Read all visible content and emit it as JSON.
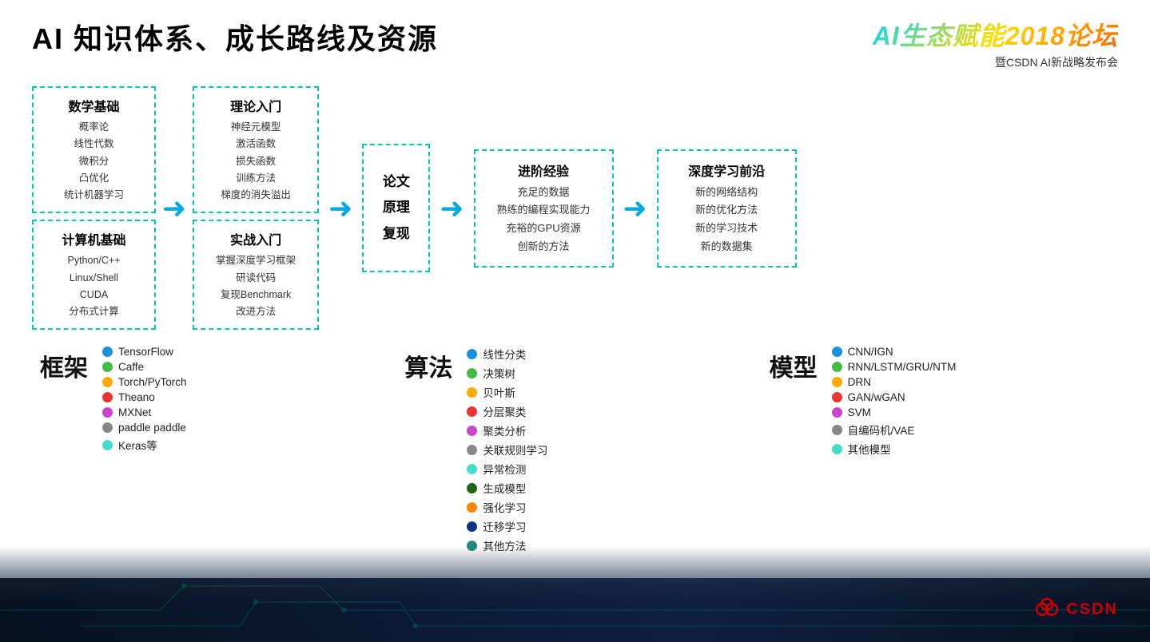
{
  "header": {
    "title": "AI 知识体系、成长路线及资源",
    "logo_main": "AI生态赋能2018论坛",
    "logo_sub": "暨CSDN AI新战略发布会"
  },
  "flow": {
    "left_col": {
      "box1": {
        "title": "数学基础",
        "items": [
          "概率论",
          "线性代数",
          "微积分",
          "凸优化",
          "统计机器学习"
        ]
      },
      "box2": {
        "title": "计算机基础",
        "items": [
          "Python/C++",
          "Linux/Shell",
          "CUDA",
          "分布式计算"
        ]
      }
    },
    "theory_col": {
      "box1": {
        "title": "理论入门",
        "items": [
          "神经元模型",
          "激活函数",
          "损失函数",
          "训练方法",
          "梯度的消失溢出"
        ]
      },
      "box2": {
        "title": "实战入门",
        "items": [
          "掌握深度学习框架",
          "研读代码",
          "复现Benchmark",
          "改进方法"
        ]
      }
    },
    "paper_box": {
      "lines": [
        "论文",
        "原理",
        "复现"
      ]
    },
    "advanced_box": {
      "title": "进阶经验",
      "items": [
        "充足的数据",
        "熟练的编程实现能力",
        "充裕的GPU资源",
        "创新的方法"
      ]
    },
    "deep_box": {
      "title": "深度学习前沿",
      "items": [
        "新的网络结构",
        "新的优化方法",
        "新的学习技术",
        "新的数据集"
      ]
    }
  },
  "legends": {
    "frameworks": {
      "title": "框架",
      "items": [
        {
          "color": "#1a90e0",
          "label": "TensorFlow"
        },
        {
          "color": "#44bb44",
          "label": "Caffe"
        },
        {
          "color": "#ffaa00",
          "label": "Torch/PyTorch"
        },
        {
          "color": "#ee3333",
          "label": "Theano"
        },
        {
          "color": "#cc44cc",
          "label": "MXNet"
        },
        {
          "color": "#888888",
          "label": "paddle paddle"
        },
        {
          "color": "#44ddcc",
          "label": "Keras等"
        }
      ]
    },
    "algorithms": {
      "title": "算法",
      "items": [
        {
          "color": "#1a90e0",
          "label": "线性分类"
        },
        {
          "color": "#44bb44",
          "label": "决策树"
        },
        {
          "color": "#ffaa00",
          "label": "贝叶斯"
        },
        {
          "color": "#ee3333",
          "label": "分层聚类"
        },
        {
          "color": "#cc44cc",
          "label": "聚类分析"
        },
        {
          "color": "#888888",
          "label": "关联规则学习"
        },
        {
          "color": "#44ddcc",
          "label": "异常检测"
        },
        {
          "color": "#226611",
          "label": "生成模型"
        },
        {
          "color": "#ff8800",
          "label": "强化学习"
        },
        {
          "color": "#113388",
          "label": "迁移学习"
        },
        {
          "color": "#228877",
          "label": "其他方法"
        }
      ]
    },
    "models": {
      "title": "模型",
      "items": [
        {
          "color": "#1a90e0",
          "label": "CNN/IGN"
        },
        {
          "color": "#44bb44",
          "label": "RNN/LSTM/GRU/NTM"
        },
        {
          "color": "#ffaa00",
          "label": "DRN"
        },
        {
          "color": "#ee3333",
          "label": "GAN/wGAN"
        },
        {
          "color": "#cc44cc",
          "label": "SVM"
        },
        {
          "color": "#888888",
          "label": "自编码机/VAE"
        },
        {
          "color": "#44ddcc",
          "label": "其他模型"
        }
      ]
    }
  },
  "csdn": {
    "label": "CSDN"
  }
}
